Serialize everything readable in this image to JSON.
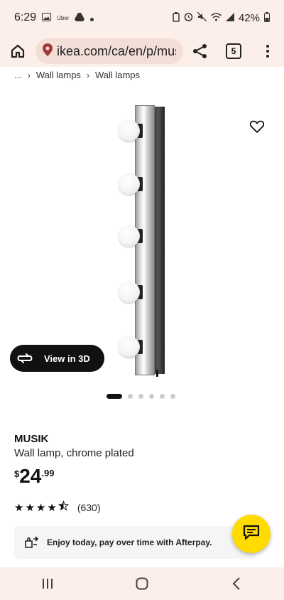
{
  "status": {
    "time": "6:29",
    "uber_label": "Uber",
    "battery": "42%"
  },
  "browser": {
    "url": "ikea.com/ca/en/p/mus",
    "tab_count": "5"
  },
  "breadcrumb": {
    "ellipsis": "...",
    "items": [
      "Wall lamps",
      "Wall lamps"
    ]
  },
  "product": {
    "view3d_label": "View in 3D",
    "carousel": {
      "total": 6,
      "active": 1
    },
    "name": "MUSIK",
    "description": "Wall lamp, chrome plated",
    "price": {
      "currency": "$",
      "integer": "24",
      "decimals": ".99"
    },
    "rating": {
      "stars": 4.5,
      "count": "(630)"
    }
  },
  "afterpay": {
    "text": "Enjoy today, pay over time with Afterpay."
  },
  "colors": {
    "chrome_bg": "#fcefe9",
    "accent_yellow": "#ffdb00",
    "dark": "#111111"
  },
  "icons": {
    "home": "home-icon",
    "location": "location-pin-icon",
    "share": "share-icon",
    "menu": "more-vert-icon",
    "favorite": "heart-icon",
    "view3d": "rotate-3d-icon",
    "afterpay": "afterpay-icon",
    "chat": "chat-icon"
  }
}
